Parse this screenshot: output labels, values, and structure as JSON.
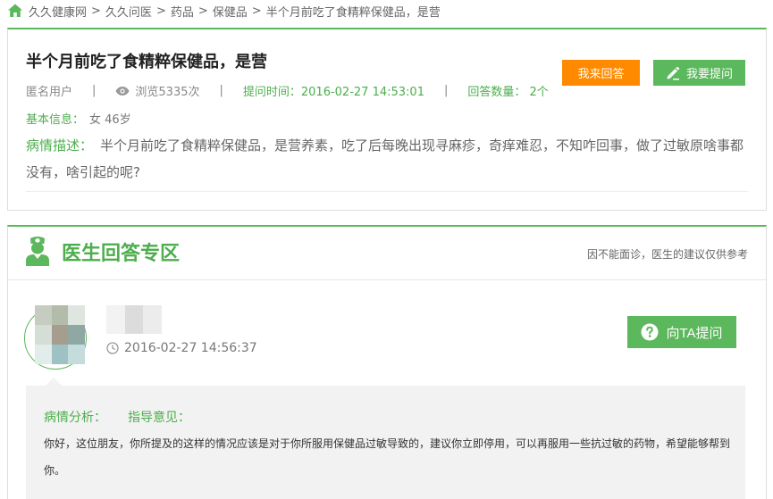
{
  "breadcrumb": {
    "items": [
      "久久健康网",
      "久久问医",
      "药品",
      "保健品",
      "半个月前吃了食精粹保健品，是营"
    ],
    "separator": ">"
  },
  "question": {
    "title": "半个月前吃了食精粹保健品，是营",
    "user": "匿名用户",
    "views": "浏览5335次",
    "ask_time": "提问时间：2016-02-27 14:53:01",
    "answer_count": "回答数量：  2个",
    "basic_label": "基本信息：",
    "basic_value": "女 46岁",
    "desc_label": "病情描述：",
    "desc_text": "半个月前吃了食精粹保健品，是营养素，吃了后每晚出现寻麻疹，奇痒难忍，不知咋回事，做了过敏原啥事都没有，啥引起的呢?",
    "answer_button": "我来回答",
    "ask_button": "我要提问"
  },
  "doctor_section": {
    "title": "医生回答专区",
    "note": "因不能面诊，医生的建议仅供参考",
    "answer_time": "2016-02-27 14:56:37",
    "ask_ta_button": "向TA提问",
    "analysis_label": "病情分析：",
    "guidance_label": "指导意见：",
    "answer_text": "你好，这位朋友，你所提及的这样的情况应该是对于你所服用保健品过敏导致的，建议你立即停用，可以再服用一些抗过敏的药物，希望能够帮到你。"
  },
  "colors": {
    "brand_green": "#5cb85c",
    "text_green": "#4cae4c",
    "orange": "#ff8a00"
  },
  "icons": {
    "home": "home-icon",
    "views": "eye-icon",
    "ask": "pencil-icon",
    "doctor": "nurse-icon",
    "time": "clock-icon",
    "ask_ta": "question-circle-icon"
  }
}
